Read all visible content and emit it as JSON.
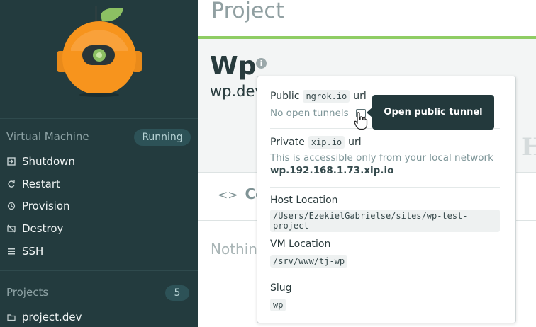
{
  "sidebar": {
    "vm_section_label": "Virtual Machine",
    "vm_status": "Running",
    "vm_actions": [
      {
        "label": "Shutdown",
        "icon": "shutdown-icon"
      },
      {
        "label": "Restart",
        "icon": "restart-icon"
      },
      {
        "label": "Provision",
        "icon": "provision-icon"
      },
      {
        "label": "Destroy",
        "icon": "destroy-icon"
      },
      {
        "label": "SSH",
        "icon": "ssh-icon"
      }
    ],
    "projects_section_label": "Projects",
    "projects_count": "5",
    "projects": [
      {
        "label": "project.dev",
        "icon": "folder-icon"
      }
    ]
  },
  "main": {
    "title": "Project",
    "project_name": "Wp",
    "project_domain": "wp.dev",
    "tab_label": "Co",
    "nothing_text": "Nothin"
  },
  "popover": {
    "public_label": "Public",
    "public_service": "ngrok.io",
    "public_suffix": "url",
    "public_status": "No open tunnels",
    "private_label": "Private",
    "private_service": "xip.io",
    "private_suffix": "url",
    "private_note": "This is accessible only from your local network",
    "private_url": "wp.192.168.1.73.xip.io",
    "host_label": "Host Location",
    "host_value": "/Users/EzekielGabrielse/sites/wp-test-project",
    "vm_label": "VM Location",
    "vm_value": "/srv/www/tj-wp",
    "slug_label": "Slug",
    "slug_value": "wp"
  },
  "tooltip": {
    "text": "Open public tunnel"
  },
  "colors": {
    "sidebar_bg": "#233b3e",
    "accent_green": "#8fcd64",
    "tooltip_bg": "#23393c"
  }
}
